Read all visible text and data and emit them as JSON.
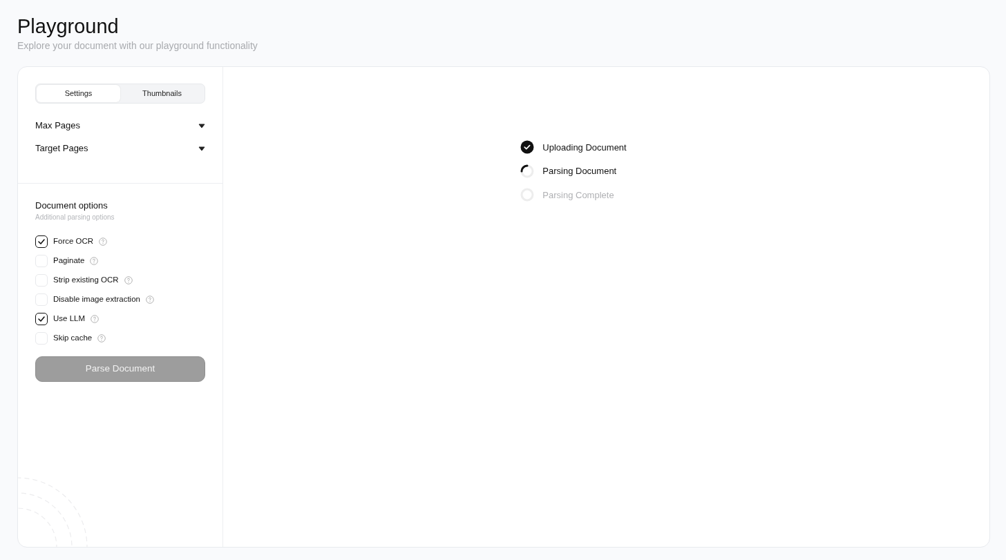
{
  "header": {
    "title": "Playground",
    "subtitle": "Explore your document with our playground functionality"
  },
  "tabs": [
    {
      "label": "Settings",
      "selected": true
    },
    {
      "label": "Thumbnails",
      "selected": false
    }
  ],
  "dropdowns": [
    {
      "label": "Max Pages",
      "expanded": false
    },
    {
      "label": "Target Pages",
      "expanded": false
    }
  ],
  "document_options": {
    "title": "Document options",
    "subtitle": "Additional parsing options",
    "options": [
      {
        "label": "Force OCR",
        "checked": true
      },
      {
        "label": "Paginate",
        "checked": false
      },
      {
        "label": "Strip existing OCR",
        "checked": false
      },
      {
        "label": "Disable image extraction",
        "checked": false
      },
      {
        "label": "Use LLM",
        "checked": true
      },
      {
        "label": "Skip cache",
        "checked": false
      }
    ]
  },
  "parse_button": {
    "label": "Parse Document",
    "disabled": true
  },
  "steps": [
    {
      "label": "Uploading Document",
      "kind": "done"
    },
    {
      "label": "Parsing Document",
      "kind": "active"
    },
    {
      "label": "Parsing Complete",
      "kind": "pending"
    }
  ]
}
